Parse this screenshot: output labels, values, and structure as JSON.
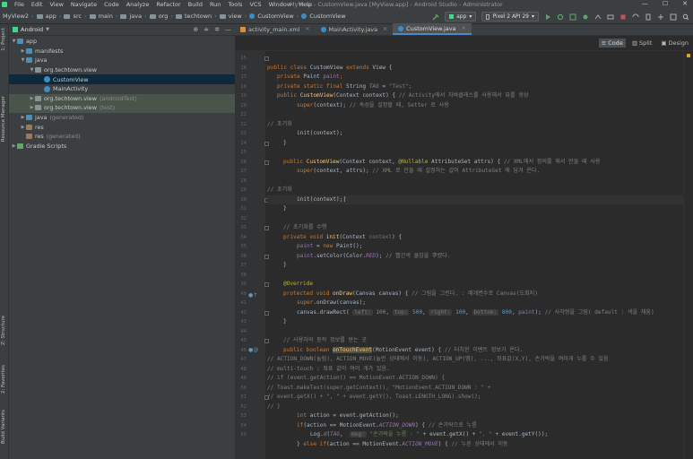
{
  "menu": [
    "File",
    "Edit",
    "View",
    "Navigate",
    "Code",
    "Analyze",
    "Refactor",
    "Build",
    "Run",
    "Tools",
    "VCS",
    "Window",
    "Help"
  ],
  "window_title": "MyView - CustomView.java [MyView.app] - Android Studio - Administrator",
  "window_controls": [
    "—",
    "☐",
    "✕"
  ],
  "breadcrumbs": [
    "MyView2",
    "app",
    "src",
    "main",
    "java",
    "org",
    "techtown",
    "view",
    "CustomView",
    "CustomView"
  ],
  "run_config": "app",
  "device": "Pixel 2 API 29",
  "project_panel": {
    "selector": "Android",
    "tree": [
      {
        "label": "app",
        "note": ""
      },
      {
        "label": "manifests",
        "note": ""
      },
      {
        "label": "java",
        "note": ""
      },
      {
        "label": "org.techtown.view",
        "note": ""
      },
      {
        "label": "CustomView",
        "note": ""
      },
      {
        "label": "MainActivity",
        "note": ""
      },
      {
        "label": "org.techtown.view",
        "note": "(androidTest)"
      },
      {
        "label": "org.techtown.view",
        "note": "(test)"
      },
      {
        "label": "java",
        "note": "(generated)"
      },
      {
        "label": "res",
        "note": ""
      },
      {
        "label": "res",
        "note": "(generated)"
      },
      {
        "label": "Gradle Scripts",
        "note": ""
      }
    ]
  },
  "side_tabs": {
    "project": "1: Project",
    "resource_manager": "Resource Manager",
    "structure": "Z: Structure",
    "favorites": "2: Favorites",
    "build_variants": "Build Variants"
  },
  "tabs": [
    {
      "label": "activity_main.xml"
    },
    {
      "label": "MainActivity.java"
    },
    {
      "label": "CustomView.java"
    }
  ],
  "view_modes": [
    "Code",
    "Split",
    "Design"
  ],
  "line_numbers": [
    "15",
    "16",
    "17",
    "18",
    "19",
    "20",
    "21",
    "22",
    "23",
    "24",
    "25",
    "26",
    "27",
    "28",
    "29",
    "30",
    "31",
    "32",
    "33",
    "34",
    "35",
    "36",
    "37",
    "38",
    "39",
    "40",
    "41",
    "42",
    "43",
    "44",
    "45",
    "46",
    "47",
    "48",
    "49",
    "50",
    "51",
    "52",
    "53",
    "54",
    "55"
  ],
  "code": {
    "l15": "",
    "l16_kw": "public class ",
    "l16_name": "CustomView ",
    "l16_kw2": "extends ",
    "l16_rest": "View {",
    "l17_kw": "private ",
    "l17_rest": "Paint ",
    "l17_f": "paint",
    "l17_end": ";",
    "l18_kw": "private static final ",
    "l18_t": "String ",
    "l18_f": "TAG",
    "l18_eq": " = ",
    "l18_s": "\"Test\"",
    "l18_end": ";",
    "l19_kw": "public ",
    "l19_fn": "CustomView",
    "l19_args": "(Context context) { ",
    "l19_cm": "// Activity에서 자바클래스를 사용해서 뷰를 생성",
    "l20_kw": "super",
    "l20_args": "(context); ",
    "l20_cm": "// 속성을 설정할 때, Setter 로 사용",
    "l22_cm": "// 초기화",
    "l23": "init(context);",
    "l24": "}",
    "l26_kw": "public ",
    "l26_fn": "CustomView",
    "l26_a": "(Context context, ",
    "l26_ann": "@Nullable ",
    "l26_b": "AttributeSet attrs) { ",
    "l26_cm": "// XML에서 정의를 해서 만들 때 사용",
    "l27_kw": "super",
    "l27_args": "(context, attrs); ",
    "l27_cm": "// XML 로 만들 때 설정하는 값이 AttributeSet 에 담겨 온다.",
    "l28_cm": "// 초기화",
    "l29": "init(context);",
    "l30": "}",
    "l32_cm": "// 초기화를 수행",
    "l33_kw": "private void ",
    "l33_fn": "init",
    "l33_a": "(Context ",
    "l33_u": "context",
    "l33_b": ") {",
    "l34_f": "paint",
    "l34_eq": " = ",
    "l34_kw": "new ",
    "l34_rest": "Paint();",
    "l35_f": "paint",
    "l35_a": ".setColor(Color.",
    "l35_i": "RED",
    "l35_b": "); ",
    "l35_cm": "// 빨간색 물감을 뿌렸다.",
    "l36": "}",
    "l38_ann": "@Override",
    "l39_kw": "protected void ",
    "l39_fn": "onDraw",
    "l39_a": "(Canvas canvas) { ",
    "l39_cm": "// 그림을 그린다. : 매개변수로 Canvas(도화지)",
    "l40_kw": "super",
    "l40_a": ".onDraw(canvas);",
    "l41_a": "canvas.drawRect( ",
    "l41_h1": "left:",
    "l41_n1": " 100",
    "l41_h2": "top:",
    "l41_n2": " 500",
    "l41_h3": "right:",
    "l41_n3": " 100",
    "l41_h4": "bottom:",
    "l41_n4": " 800",
    "l41_f": "paint",
    "l41_b": "); ",
    "l41_cm": "// 사각형을 그림( default : 색을 채움)",
    "l42": "}",
    "l44_cm": "// 사용자의 동작 정보를 받는 곳",
    "l45_kw": "public boolean ",
    "l45_fn": "onTouchEvent",
    "l45_a": "(MotionEvent event) { ",
    "l45_cm": "// 터치한 이벤트 정보가 온다.",
    "l46_cm": "// ACTION_DOWN(눌림), ACTION_MOVE(눌린 상태에서 이동), ACTION_UP(뗌), ..., 좌표값(X,Y), 손가락을 여러개 누를 수 있음",
    "l47_cm": "// multi-touch : 좌표 값이 여러 개가 있음.",
    "l48_cm": "// if (event.getAction() == MotionEvent.ACTION_DOWN) {",
    "l49_cm": "// Toast.makeText(super.getContext(), \"MotionEvent.ACTION_DOWN : \" +",
    "l50_cm": "// event.getX() + \", \" + event.getY(), Toast.LENGTH_LONG).show();",
    "l51_cm": "// }",
    "l52_kw": "int ",
    "l52_a": "action = event.getAction();",
    "l53_kw": "if",
    "l53_a": "(action == MotionEvent.",
    "l53_i": "ACTION_DOWN",
    "l53_b": ") { ",
    "l53_cm": "// 손가락으로 누름",
    "l54_a": "Log.",
    "l54_i": "d",
    "l54_b": "(",
    "l54_f": "TAG",
    "l54_c": ",  ",
    "l54_h": "msg:",
    "l54_s": " \"손가락을 누름 : \"",
    "l54_d": " + event.getX() + ",
    "l54_s2": "\", \"",
    "l54_e": " + event.getY());",
    "l55_a": "} ",
    "l55_kw": "else if",
    "l55_b": "(action == MotionEvent.",
    "l55_i": "ACTION_MOVE",
    "l55_c": ") { ",
    "l55_cm": "// 누른 상태에서 이동"
  },
  "colors": {
    "background": "#2b2b2b",
    "panel": "#3c3f41",
    "keyword": "#cc7832",
    "string": "#6a8759",
    "comment": "#808080",
    "function": "#ffc66d",
    "field": "#9876aa",
    "accent": "#4a88c7"
  }
}
